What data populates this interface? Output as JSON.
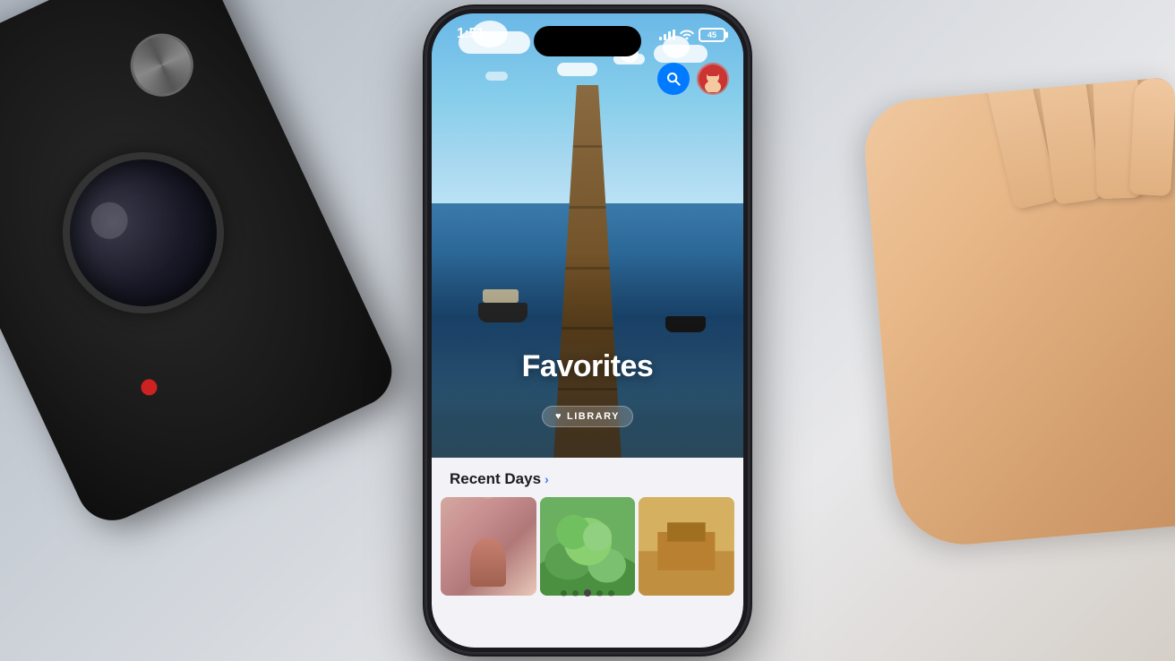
{
  "scene": {
    "background_color": "#c8cdd4"
  },
  "status_bar": {
    "time": "1:51",
    "battery_level": "45",
    "signal": "full",
    "wifi": true
  },
  "hero": {
    "title": "Favorites",
    "badge_label": "LIBRARY",
    "badge_icon": "♥"
  },
  "dots": {
    "count": 5,
    "active_index": 2
  },
  "recent_days": {
    "label": "Recent Days",
    "chevron": "›"
  },
  "icons": {
    "search": "🔍",
    "avatar_emoji": "🧒"
  }
}
